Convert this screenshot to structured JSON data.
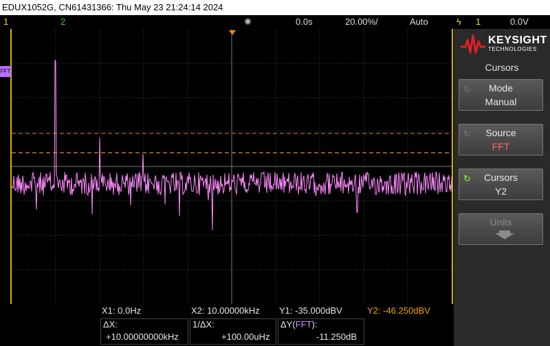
{
  "header": {
    "title": "EDUX1052G, CN61431366: Thu May 23 21:24:14 2024"
  },
  "status": {
    "ch1": "1",
    "ch2": "2",
    "delay": "0.0s",
    "timebase": "20.00%/",
    "trigger_mode": "Auto",
    "trigger_channel": "1",
    "trigger_level": "0.0V"
  },
  "fft_marker": "FFT",
  "logo": {
    "brand": "KEYSIGHT",
    "sub": "TECHNOLOGIES"
  },
  "menu": {
    "title": "Cursors",
    "softkeys": [
      {
        "label": "Mode",
        "value": "Manual"
      },
      {
        "label": "Source",
        "value": "FFT"
      },
      {
        "label": "Cursors",
        "value": "Y2"
      },
      {
        "label": "Units",
        "value": ""
      }
    ]
  },
  "readout": {
    "x1": "X1:  0.0Hz",
    "x2": "X2:  10.00000kHz",
    "y1": "Y1: -35.000dBV",
    "y2": "Y2: -46.250dBV",
    "dx_label": "ΔX:",
    "dx_value": "+10.00000000kHz",
    "inv_dx_label": "1/ΔX:",
    "inv_dx_value": "+100.00uHz",
    "dy_label": "ΔY(",
    "dy_src": "FFT",
    "dy_close": "):",
    "dy_value": "-11.250dB"
  },
  "colors": {
    "trace": "#ff8cff",
    "cursor": "#c85a2a",
    "grid": "#5a5a5a"
  }
}
